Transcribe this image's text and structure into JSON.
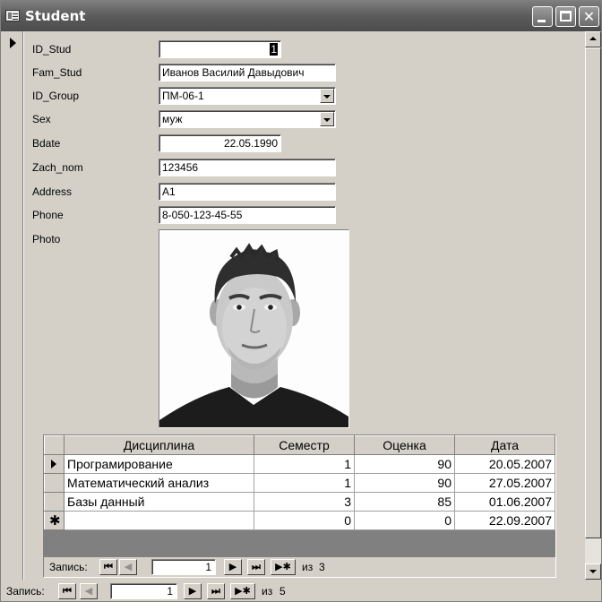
{
  "window": {
    "title": "Student",
    "icon": "form-icon"
  },
  "form": {
    "fields": [
      {
        "key": "id_stud",
        "label": "ID_Stud",
        "value": "1"
      },
      {
        "key": "fam_stud",
        "label": "Fam_Stud",
        "value": "Иванов Василий Давыдович"
      },
      {
        "key": "id_group",
        "label": "ID_Group",
        "value": "ПМ-06-1"
      },
      {
        "key": "sex",
        "label": "Sex",
        "value": "муж"
      },
      {
        "key": "bdate",
        "label": "Bdate",
        "value": "22.05.1990"
      },
      {
        "key": "zach_nom",
        "label": "Zach_nom",
        "value": "123456"
      },
      {
        "key": "address",
        "label": "Address",
        "value": "A1"
      },
      {
        "key": "phone",
        "label": "Phone",
        "value": "8-050-123-45-55"
      }
    ],
    "photo_label": "Photo"
  },
  "subform": {
    "columns": [
      "Дисциплина",
      "Семестр",
      "Оценка",
      "Дата"
    ],
    "rows": [
      {
        "discipline": "Програмирование",
        "semester": "1",
        "grade": "90",
        "date": "20.05.2007"
      },
      {
        "discipline": "Математический анализ",
        "semester": "1",
        "grade": "90",
        "date": "27.05.2007"
      },
      {
        "discipline": "Базы данный",
        "semester": "3",
        "grade": "85",
        "date": "01.06.2007"
      }
    ],
    "new_row": {
      "discipline": "",
      "semester": "0",
      "grade": "0",
      "date": "22.09.2007"
    },
    "nav": {
      "caption": "Запись:",
      "current": "1",
      "of": "из",
      "total": "3"
    }
  },
  "main_nav": {
    "caption": "Запись:",
    "current": "1",
    "of": "из",
    "total": "5"
  },
  "nav_icons": {
    "first": "⏮",
    "prev": "◀",
    "next": "▶",
    "last": "⏭",
    "new": "▶✱"
  }
}
